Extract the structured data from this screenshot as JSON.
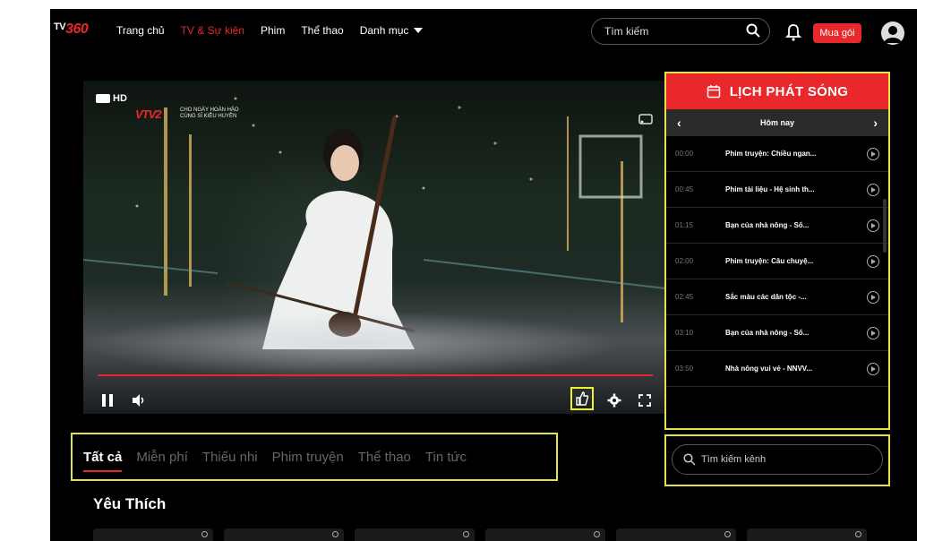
{
  "header": {
    "logo_prefix": "TV",
    "logo_number": "360",
    "nav": [
      {
        "label": "Trang chủ"
      },
      {
        "label": "TV & Sự kiện"
      },
      {
        "label": "Phim"
      },
      {
        "label": "Thể thao"
      },
      {
        "label": "Danh mục"
      }
    ],
    "search_placeholder": "Tìm kiếm",
    "buy_label": "Mua gói"
  },
  "player": {
    "channel_logo": "HD",
    "channel_name": "VTV2",
    "program_tag_line1": "CHO NGÀY HOÀN HẢO",
    "program_tag_line2": "CÙNG SĨ KIỀU HUYỀN"
  },
  "schedule": {
    "title": "LỊCH PHÁT SÓNG",
    "day_label": "Hôm nay",
    "items": [
      {
        "time": "00:00",
        "title": "Phim truyện: Chiều ngan..."
      },
      {
        "time": "00:45",
        "title": "Phim tài liệu - Hệ sinh th..."
      },
      {
        "time": "01:15",
        "title": "Bạn của nhà nông - Số..."
      },
      {
        "time": "02:00",
        "title": "Phim truyện: Câu chuyệ..."
      },
      {
        "time": "02:45",
        "title": "Sắc màu các dân tộc -..."
      },
      {
        "time": "03:10",
        "title": "Bạn của nhà nông - Số..."
      },
      {
        "time": "03:50",
        "title": "Nhà nông vui vẻ - NNVV..."
      }
    ]
  },
  "tabs": [
    {
      "label": "Tất cả"
    },
    {
      "label": "Miễn phí"
    },
    {
      "label": "Thiếu nhi"
    },
    {
      "label": "Phim truyện"
    },
    {
      "label": "Thể thao"
    },
    {
      "label": "Tin tức"
    }
  ],
  "channel_search_placeholder": "Tìm kiếm kênh",
  "favorites_title": "Yêu Thích",
  "colors": {
    "accent": "#e8282b",
    "highlight": "#e8e14a"
  }
}
